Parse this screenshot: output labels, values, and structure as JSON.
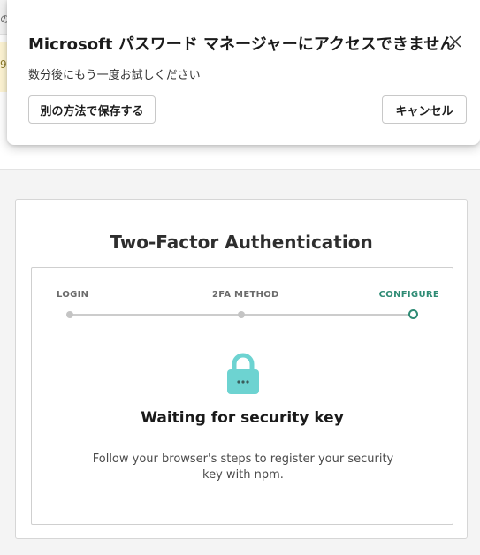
{
  "background": {
    "left_strip_text": "の",
    "yellow_strip_text": "9"
  },
  "popup": {
    "title": "Microsoft パスワード マネージャーにアクセスできません",
    "subtitle": "数分後にもう一度お試しください",
    "alt_button_label": "別の方法で保存する",
    "cancel_button_label": "キャンセル",
    "close_icon": "close-icon"
  },
  "tfa": {
    "title": "Two-Factor Authentication",
    "steps": [
      {
        "label": "LOGIN",
        "state": "done"
      },
      {
        "label": "2FA METHOD",
        "state": "done"
      },
      {
        "label": "CONFIGURE",
        "state": "current"
      }
    ],
    "status_icon": "lock-icon",
    "heading": "Waiting for security key",
    "description": "Follow your browser's steps to register your security key with npm."
  },
  "colors": {
    "accent": "#2e8b74",
    "lock": "#6dd3d1",
    "step_inactive": "#c4c4c4"
  }
}
